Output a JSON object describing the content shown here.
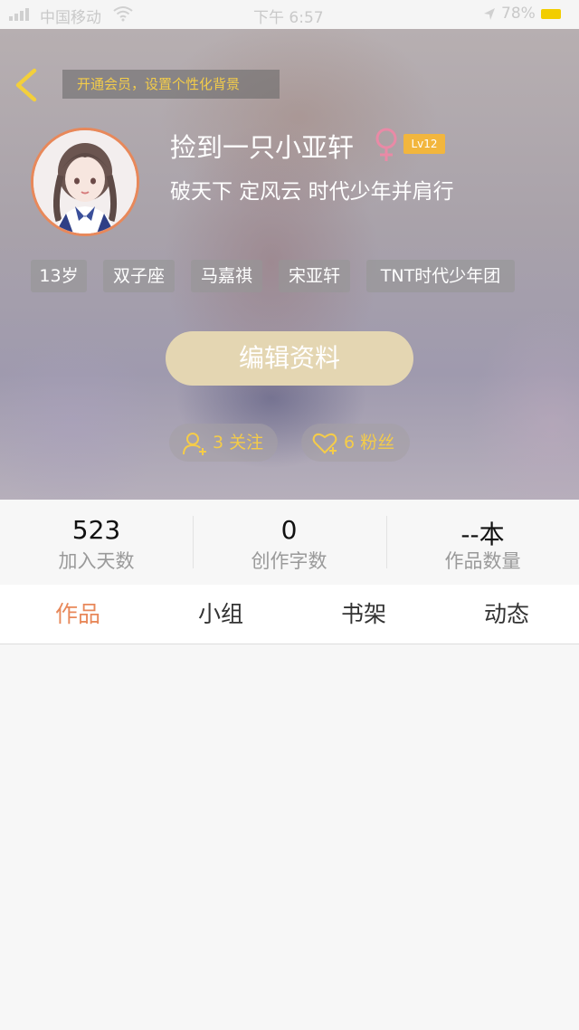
{
  "status_bar": {
    "carrier": "中国移动",
    "time": "下午 6:57",
    "battery_pct": "78%"
  },
  "profile": {
    "vip_banner": "开通会员，设置个性化背景",
    "nickname": "捡到一只小亚轩",
    "gender": "female",
    "level": "Lv12",
    "signature": "破天下 定风云 时代少年并肩行",
    "tags": [
      "13岁",
      "双子座",
      "马嘉祺",
      "宋亚轩",
      "TNT时代少年团"
    ],
    "edit_button": "编辑资料",
    "follow": "3 关注",
    "fans": "6 粉丝"
  },
  "stats": [
    {
      "value": "523",
      "label": "加入天数"
    },
    {
      "value": "0",
      "label": "创作字数"
    },
    {
      "value": "--本",
      "label": "作品数量"
    }
  ],
  "tabs": [
    {
      "label": "作品",
      "active": true
    },
    {
      "label": "小组",
      "active": false
    },
    {
      "label": "书架",
      "active": false
    },
    {
      "label": "动态",
      "active": false
    }
  ],
  "colors": {
    "accent": "#e8885a",
    "gold_text": "#f5cc49",
    "edit_button": "#e4d6b2",
    "level_badge": "#f2b63d"
  }
}
